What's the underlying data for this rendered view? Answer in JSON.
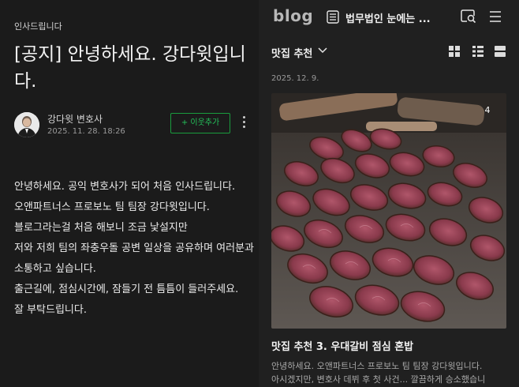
{
  "left": {
    "category": "인사드립니다",
    "title": "[공지] 안녕하세요. 강다윗입니다.",
    "author": {
      "name": "강다윗 변호사",
      "date": "2025. 11. 28. 18:26",
      "follow_label": "+ 이웃추가"
    },
    "body": [
      "안녕하세요. 공익 변호사가 되어 처음 인사드립니다.",
      "오앤파트너스 프로보노 팀 팀장 강다윗입니다.",
      "블로그라는걸 처음 해보니 조금 낯설지만",
      "저와 저희 팀의 좌충우돌 공변 일상을 공유하며 여러분과 소통하고 싶습니다.",
      "출근길에, 점심시간에, 잠들기 전 틈틈이 들러주세요.",
      "잘 부탁드립니다."
    ]
  },
  "right": {
    "logo": "blog",
    "blog_title": "법무법인 눈에는 ...",
    "category_label": "맛집 추천",
    "post": {
      "date": "2025. 12. 9.",
      "photo_count": "4",
      "title": "맛집 추천 3. 우대갈비 점심 혼밥",
      "excerpt": [
        "안녕하세요. 오앤파트너스 프로보노 팀 팀장 강다윗입니다.",
        "아시겠지만, 변호사 데뷔 후 첫 사건... 깔끔하게 승소했습니"
      ]
    }
  },
  "icons": {
    "blog_list": "blog-list-icon",
    "chat_search": "chat-search-icon",
    "menu": "hamburger-menu-icon",
    "view_grid": "grid-view-icon",
    "view_list": "list-view-icon",
    "view_card": "card-view-icon"
  },
  "colors": {
    "accent_green": "#24c15a",
    "background_left": "#1b1b1b",
    "background_right": "#202020"
  }
}
